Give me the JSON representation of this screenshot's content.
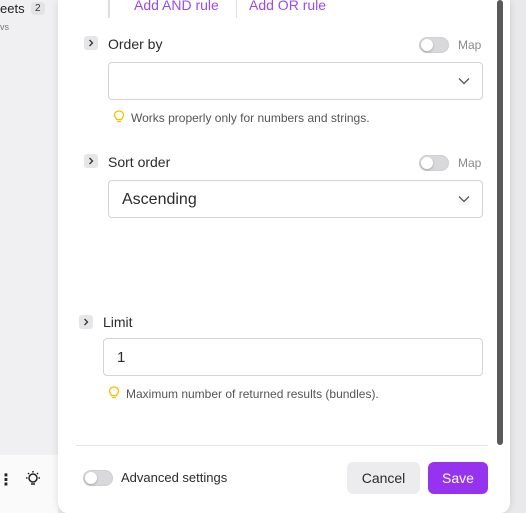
{
  "background_app": {
    "title": "eets",
    "count": "2",
    "subtitle": "vs"
  },
  "rules": {
    "add_and": "Add AND rule",
    "add_or": "Add OR rule"
  },
  "order_by": {
    "label": "Order by",
    "map_label": "Map",
    "map_enabled": false,
    "value": "",
    "hint": "Works properly only for numbers and strings."
  },
  "sort_order": {
    "label": "Sort order",
    "map_label": "Map",
    "map_enabled": false,
    "value": "Ascending"
  },
  "limit": {
    "label": "Limit",
    "value": "1",
    "hint": "Maximum number of returned results (bundles)."
  },
  "footer": {
    "advanced_label": "Advanced settings",
    "advanced_enabled": false,
    "cancel_label": "Cancel",
    "save_label": "Save"
  },
  "colors": {
    "accent": "#9533ee",
    "link": "#9c4ae8",
    "hint_icon": "#f2c200"
  },
  "icons": [
    "chevron-right-icon",
    "chevron-down-icon",
    "lightbulb-icon",
    "more-vertical-icon"
  ]
}
